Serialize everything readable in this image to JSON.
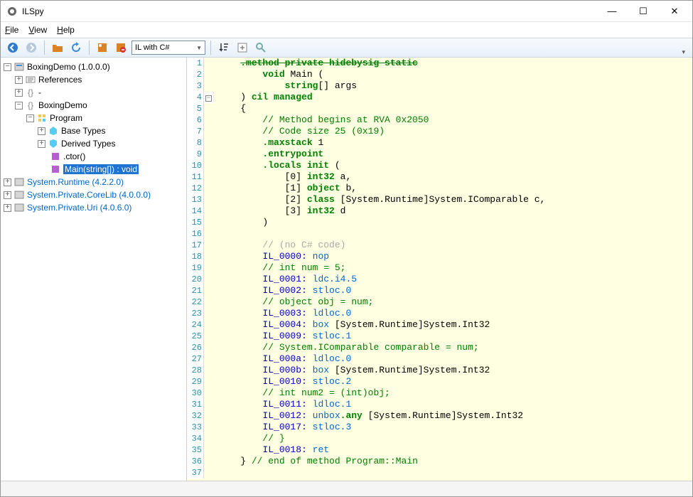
{
  "window": {
    "title": "ILSpy",
    "minimize": "—",
    "maximize": "☐",
    "close": "✕"
  },
  "menu": {
    "file": "File",
    "view": "View",
    "help": "Help"
  },
  "toolbar": {
    "combo_value": "IL with C#"
  },
  "tree": {
    "n0": "BoxingDemo (1.0.0.0)",
    "n1": "References",
    "n2": "-",
    "n3": "BoxingDemo",
    "n4": "Program",
    "n5": "Base Types",
    "n6": "Derived Types",
    "n7": ".ctor()",
    "n8": "Main(string[]) : void",
    "n9": "System.Runtime (4.2.2.0)",
    "n10": "System.Private.CoreLib (4.0.0.0)",
    "n11": "System.Private.Uri (4.0.6.0)"
  },
  "code": {
    "header_strike": ".method private hidebysig static",
    "l2a": "void",
    "l2b": " Main (",
    "l3a": "string",
    "l3b": "[] args",
    "l4a": ") ",
    "l4b": "cil managed",
    "l5": "{",
    "l6": "// Method begins at RVA 0x2050",
    "l7": "// Code size 25 (0x19)",
    "l8a": ".maxstack",
    "l8b": " 1",
    "l9": ".entrypoint",
    "l10a": ".locals init",
    "l10b": " (",
    "l11a": "[0] ",
    "l11b": "int32",
    "l11c": " a,",
    "l12a": "[1] ",
    "l12b": "object",
    "l12c": " b,",
    "l13a": "[2] ",
    "l13b": "class",
    "l13c": " [System.Runtime]System.IComparable c,",
    "l14a": "[3] ",
    "l14b": "int32",
    "l14c": " d",
    "l15": ")",
    "l17": "// (no C# code)",
    "l18a": "IL_0000:",
    "l18b": " nop",
    "l19": "// int num = 5;",
    "l20a": "IL_0001:",
    "l20b": " ldc.i4.5",
    "l21a": "IL_0002:",
    "l21b": " stloc.0",
    "l22": "// object obj = num;",
    "l23a": "IL_0003:",
    "l23b": " ldloc.0",
    "l24a": "IL_0004:",
    "l24b": " box",
    "l24c": " [System.Runtime]System.Int32",
    "l25a": "IL_0009:",
    "l25b": " stloc.1",
    "l26": "// System.IComparable comparable = num;",
    "l27a": "IL_000a:",
    "l27b": " ldloc.0",
    "l28a": "IL_000b:",
    "l28b": " box",
    "l28c": " [System.Runtime]System.Int32",
    "l29a": "IL_0010:",
    "l29b": " stloc.2",
    "l30": "// int num2 = (int)obj;",
    "l31a": "IL_0011:",
    "l31b": " ldloc.1",
    "l32a": "IL_0012:",
    "l32b": " unbox",
    "l32c": ".any",
    "l32d": " [System.Runtime]System.Int32",
    "l33a": "IL_0017:",
    "l33b": " stloc.3",
    "l34": "// }",
    "l35a": "IL_0018:",
    "l35b": " ret",
    "l36a": "} ",
    "l36b": "// end of method Program::Main"
  }
}
